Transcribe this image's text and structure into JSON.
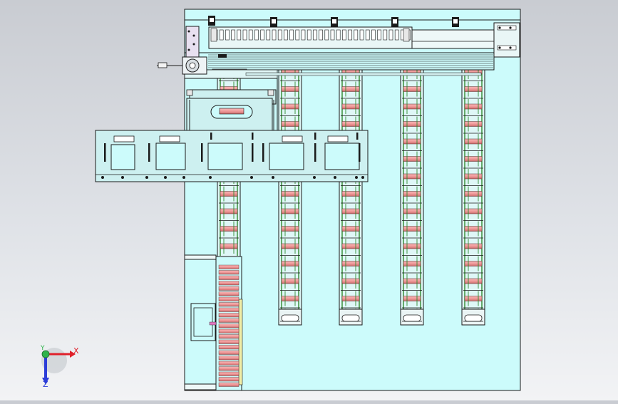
{
  "triad": {
    "x_label": "X",
    "y_label": "Y",
    "z_label": "Z",
    "colors": {
      "x": "#e0202a",
      "y": "#2fb34a",
      "z": "#2c3dd8"
    }
  },
  "colors": {
    "background_top": "#c9ccd2",
    "background_bottom": "#f2f3f5",
    "sheet": "#ccfbfb",
    "plate": "#cdf0f0",
    "outline": "#1a1a1a",
    "chain_rail": "#2f8a2f",
    "roller": "#f09a9a",
    "roller_shadow": "#c86a6a",
    "gray": "#bfc4c8"
  },
  "model": {
    "lanes": [
      {
        "id": "lane-1",
        "name": "conveyor-lane-1"
      },
      {
        "id": "lane-2",
        "name": "conveyor-lane-2"
      },
      {
        "id": "lane-3",
        "name": "conveyor-lane-3"
      },
      {
        "id": "lane-4",
        "name": "conveyor-lane-4"
      },
      {
        "id": "lane-5",
        "name": "conveyor-lane-5"
      }
    ]
  }
}
